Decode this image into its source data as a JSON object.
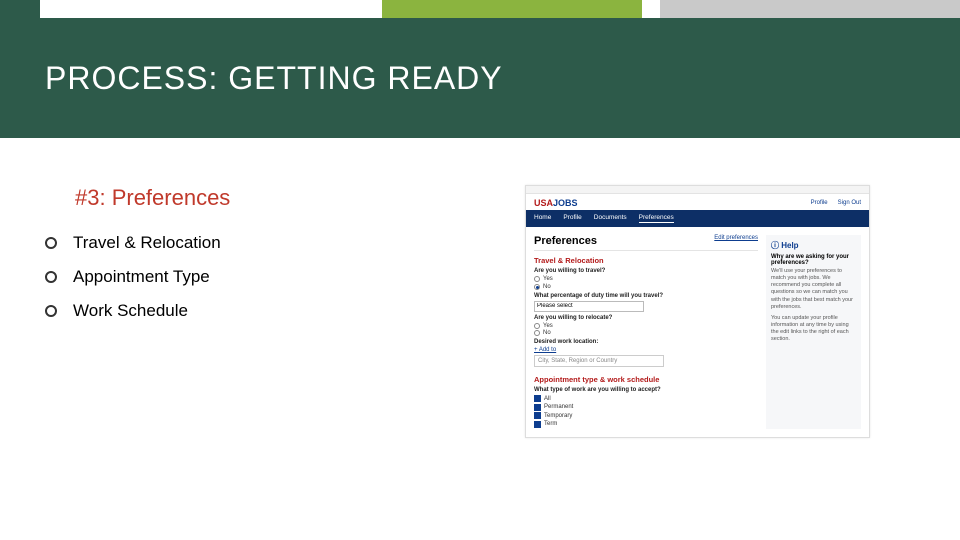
{
  "title": "PROCESS: GETTING READY",
  "subheading": "#3: Preferences",
  "bullets": [
    "Travel & Relocation",
    "Appointment Type",
    "Work Schedule"
  ],
  "mock": {
    "logo_a": "USA",
    "logo_b": "JOBS",
    "acct_profile": "Profile",
    "acct_signout": "Sign Out",
    "nav": [
      "Home",
      "Profile",
      "Documents",
      "Preferences"
    ],
    "nav_active_index": 3,
    "prefs_title": "Preferences",
    "edit": "Edit preferences",
    "sect_travel": "Travel & Relocation",
    "q_travel": "Are you willing to travel?",
    "opt_yes": "Yes",
    "opt_no": "No",
    "q_pct": "What percentage of duty time will you travel?",
    "select_pct": "Please select",
    "q_relocate": "Are you willing to relocate?",
    "q_where": "Desired work location:",
    "link_add": "+ Add to",
    "loc_placeholder": "City, State, Region or Country",
    "sect_appt": "Appointment type & work schedule",
    "q_appt": "What type of work are you willing to accept?",
    "appt_opts": [
      "All",
      "Permanent",
      "Temporary",
      "Term"
    ],
    "help_title": "Help",
    "help_sub": "Why are we asking for your preferences?",
    "help_p1": "We'll use your preferences to match you with jobs. We recommend you complete all questions so we can match you with the jobs that best match your preferences.",
    "help_p2": "You can update your profile information at any time by using the edit links to the right of each section."
  }
}
